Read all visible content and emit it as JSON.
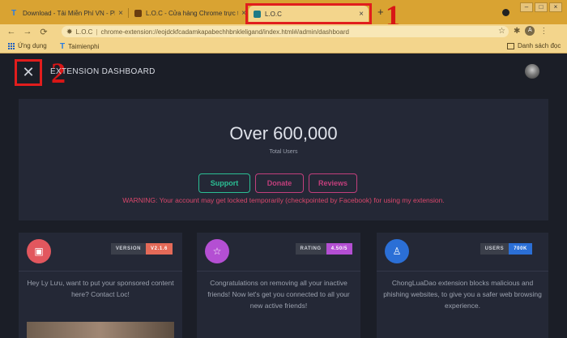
{
  "browser": {
    "tabs": [
      {
        "title": "Download - Tải Miễn Phí VN - Ph",
        "active": false
      },
      {
        "title": "L.O.C - Cửa hàng Chrome trực tu",
        "active": false
      },
      {
        "title": "L.O.C",
        "active": true
      }
    ],
    "new_tab": "+",
    "address": {
      "ext_name": "L.O.C",
      "url": "chrome-extension://eojdckfcadamkapabechhbnkleligand/index.html#/admin/dashboard"
    },
    "profile_initial": "A",
    "bookmarks": {
      "apps": "Ứng dụng",
      "item1": "Taimienphi",
      "reading_list": "Danh sách đọc"
    }
  },
  "annotations": {
    "step1": "1",
    "step2": "2"
  },
  "dashboard": {
    "title": "EXTENSION DASHBOARD",
    "hero": {
      "count": "Over 600,000",
      "subtitle": "Total Users",
      "buttons": {
        "support": "Support",
        "donate": "Donate",
        "reviews": "Reviews"
      },
      "warning": "WARNING: Your account may get locked temporarily (checkpointed by Facebook) for using my extension."
    },
    "cards": [
      {
        "badge_key": "VERSION",
        "badge_value": "V2.1.6",
        "text": "Hey Ly Lưu, want to put your sponsored content here? Contact Loc!"
      },
      {
        "badge_key": "RATING",
        "badge_value": "4.50/5",
        "text": "Congratulations on removing all your inactive friends! Now let's get you connected to all your new active friends!"
      },
      {
        "badge_key": "USERS",
        "badge_value": "700K",
        "text": "ChongLuaDao extension blocks malicious and phishing websites, to give you a safer web browsing experience."
      }
    ]
  },
  "colors": {
    "tabstrip": "#d9a332",
    "dashboard_bg": "#1b1e27",
    "card_bg": "#242836",
    "highlight": "#e11d1d",
    "support": "#2bbf94",
    "donate": "#c23f7c",
    "warning": "#d9476b"
  }
}
